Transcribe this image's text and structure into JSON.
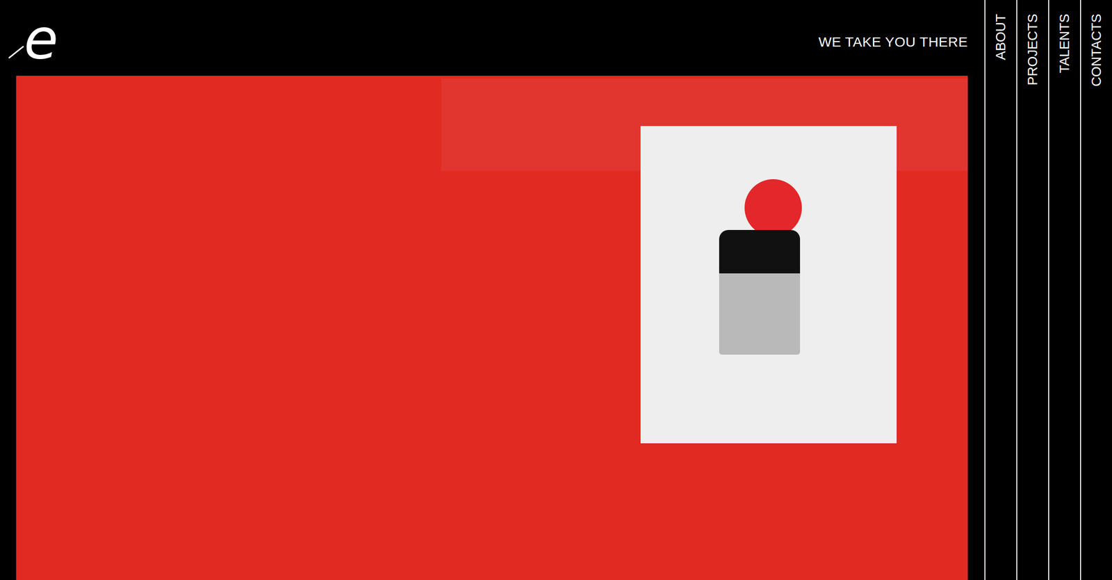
{
  "logo": {
    "text": "e"
  },
  "header": {
    "tagline": "WE TAKE YOU THERE"
  },
  "nav": {
    "items": [
      {
        "label": "ABOUT"
      },
      {
        "label": "PROJECTS"
      },
      {
        "label": "TALENTS"
      },
      {
        "label": "CONTACTS"
      }
    ]
  }
}
